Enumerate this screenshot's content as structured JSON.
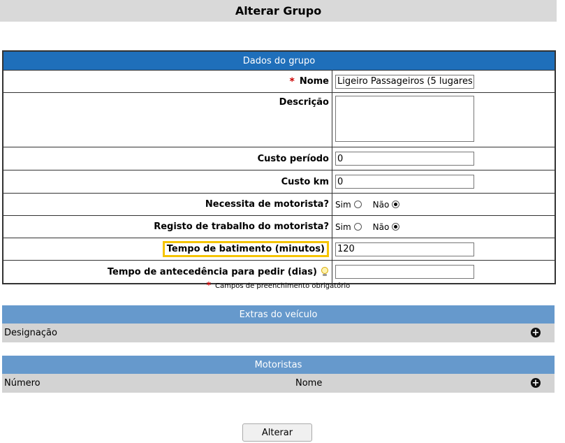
{
  "page": {
    "title": "Alterar Grupo"
  },
  "form": {
    "header": "Dados do grupo",
    "fields": {
      "nome": {
        "label": "Nome",
        "value": "Ligeiro Passageiros (5 lugares"
      },
      "descricao": {
        "label": "Descrição",
        "value": ""
      },
      "custo_periodo": {
        "label": "Custo período",
        "value": "0"
      },
      "custo_km": {
        "label": "Custo km",
        "value": "0"
      },
      "necessita_motorista": {
        "label": "Necessita de motorista?",
        "yes": "Sim",
        "no": "Não",
        "selected": "Não"
      },
      "registo_trabalho": {
        "label": "Registo de trabalho do motorista?",
        "yes": "Sim",
        "no": "Não",
        "selected": "Não"
      },
      "tempo_batimento": {
        "label": "Tempo de batimento (minutos)",
        "value": "120"
      },
      "tempo_antecedencia": {
        "label": "Tempo de antecedência para pedir (dias)",
        "value": ""
      }
    },
    "required_note": "Campos de preenchimento obrigatório",
    "required_marker": "*"
  },
  "extras": {
    "header": "Extras do veículo",
    "columns": [
      "Designação"
    ]
  },
  "motoristas": {
    "header": "Motoristas",
    "columns": [
      "Número",
      "Nome"
    ]
  },
  "actions": {
    "submit_label": "Alterar"
  },
  "colors": {
    "form_header": "#1f6fba",
    "section_header": "#6699cc",
    "highlight": "#f5c400",
    "required": "#cc0000"
  }
}
